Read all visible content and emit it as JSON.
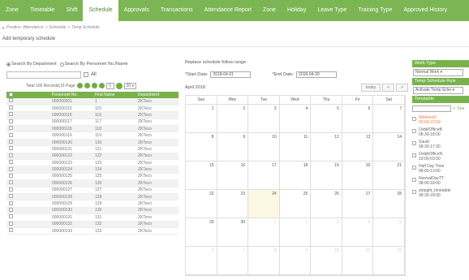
{
  "nav": {
    "tabs": [
      "Zone",
      "Timetable",
      "Shift",
      "Schedule",
      "Approvals",
      "Transactions",
      "Attendance Report",
      "Zone",
      "Holiday",
      "Leave Type",
      "Training Type",
      "Approved History"
    ]
  },
  "breadcrumb": [
    "Position: Attendance",
    "Schedule",
    "Temp Schedule"
  ],
  "page_title": "Add temporary schedule",
  "left": {
    "radio_dept": "Search By Department",
    "radio_person": "Search By Personnel No./Name",
    "all_label": "All",
    "pager_text": "Total 105 Records(15 Page",
    "page_input": "1",
    "page_size": "20",
    "columns": [
      "Personnel No.",
      "First Name",
      "Department"
    ],
    "rows": [
      [
        "000000001",
        "1",
        "ZKTeco"
      ],
      [
        "000000115",
        "115",
        "ZKTeco"
      ],
      [
        "000000116",
        "116",
        "ZKTeco"
      ],
      [
        "000000117",
        "117",
        "ZKTeco"
      ],
      [
        "000000118",
        "118",
        "ZKTeco"
      ],
      [
        "000000119",
        "119",
        "ZKTeco"
      ],
      [
        "000000120",
        "120",
        "ZKTeco"
      ],
      [
        "000000121",
        "121",
        "ZKTeco"
      ],
      [
        "000000122",
        "122",
        "ZKTeco"
      ],
      [
        "000000123",
        "123",
        "ZKTeco"
      ],
      [
        "000000124",
        "124",
        "ZKTeco"
      ],
      [
        "000000125",
        "125",
        "ZKTeco"
      ],
      [
        "000000126",
        "126",
        "ZKTeco"
      ],
      [
        "000000127",
        "127",
        "ZKTeco"
      ],
      [
        "000000128",
        "128",
        "ZKTeco"
      ],
      [
        "000000129",
        "129",
        "ZKTeco"
      ],
      [
        "000000130",
        "130",
        "ZKTeco"
      ],
      [
        "000000131",
        "131",
        "ZKTeco"
      ],
      [
        "000000132",
        "132",
        "ZKTeco"
      ],
      [
        "000000133",
        "133",
        "ZKTeco"
      ]
    ]
  },
  "calendar": {
    "replace_label": "Replace schedule follow range:",
    "start_label": "*Start Date:",
    "start_value": "2018-04-01",
    "end_label": "*End Date:",
    "end_value": "2018-04-30",
    "month": "April 2018",
    "today_btn": "today",
    "prev_icon": "<",
    "next_icon": ">",
    "weekdays": [
      "Sun",
      "Mon",
      "Tue",
      "Wed",
      "Thu",
      "Fri",
      "Sat"
    ],
    "weeks": [
      [
        {
          "d": "1"
        },
        {
          "d": "2"
        },
        {
          "d": "3"
        },
        {
          "d": "4"
        },
        {
          "d": "5"
        },
        {
          "d": "6"
        },
        {
          "d": "7"
        }
      ],
      [
        {
          "d": "8"
        },
        {
          "d": "9"
        },
        {
          "d": "10"
        },
        {
          "d": "11"
        },
        {
          "d": "12"
        },
        {
          "d": "13"
        },
        {
          "d": "14"
        }
      ],
      [
        {
          "d": "15"
        },
        {
          "d": "16"
        },
        {
          "d": "17"
        },
        {
          "d": "18"
        },
        {
          "d": "19"
        },
        {
          "d": "20"
        },
        {
          "d": "21"
        }
      ],
      [
        {
          "d": "22"
        },
        {
          "d": "23"
        },
        {
          "d": "24",
          "today": true
        },
        {
          "d": "25"
        },
        {
          "d": "26"
        },
        {
          "d": "27"
        },
        {
          "d": "28"
        }
      ],
      [
        {
          "d": "29"
        },
        {
          "d": "30"
        },
        {
          "d": "1",
          "other": true
        },
        {
          "d": "2",
          "other": true
        },
        {
          "d": "3",
          "other": true
        },
        {
          "d": "4",
          "other": true
        },
        {
          "d": "5",
          "other": true
        }
      ],
      [
        {
          "d": "6",
          "other": true
        },
        {
          "d": "7",
          "other": true
        },
        {
          "d": "8",
          "other": true
        },
        {
          "d": "9",
          "other": true
        },
        {
          "d": "10",
          "other": true
        },
        {
          "d": "11",
          "other": true
        },
        {
          "d": "12",
          "other": true
        }
      ]
    ]
  },
  "right": {
    "work_type_label": "Work Type",
    "work_type_value": "Normal Work",
    "temp_rule_label": "Temp Schedule Rule",
    "temp_rule_value": "Activate Temp Sche",
    "timetable_label": "Timetable",
    "search_link": "Sea",
    "timetables": [
      {
        "name": "Weekend",
        "time": "00:00-23:59",
        "highlight": true
      },
      {
        "name": "OvbillOfficeB",
        "time": "08:30-18:00"
      },
      {
        "name": "Saudi",
        "time": "08:30-17:30"
      },
      {
        "name": "OvbillOfficeN",
        "time": "19:00-03:00"
      },
      {
        "name": "Half Day Time",
        "time": "08:00-13:00"
      },
      {
        "name": "NormalDayTT",
        "time": "08:00-18:00"
      },
      {
        "name": "straight_timetable",
        "time": "08:30-18:00"
      }
    ]
  },
  "colors": {
    "accent_green": "#7cb554",
    "header_green": "#78b24c",
    "highlight_orange": "#f07a3b",
    "today_bg": "#fcf8e3"
  }
}
